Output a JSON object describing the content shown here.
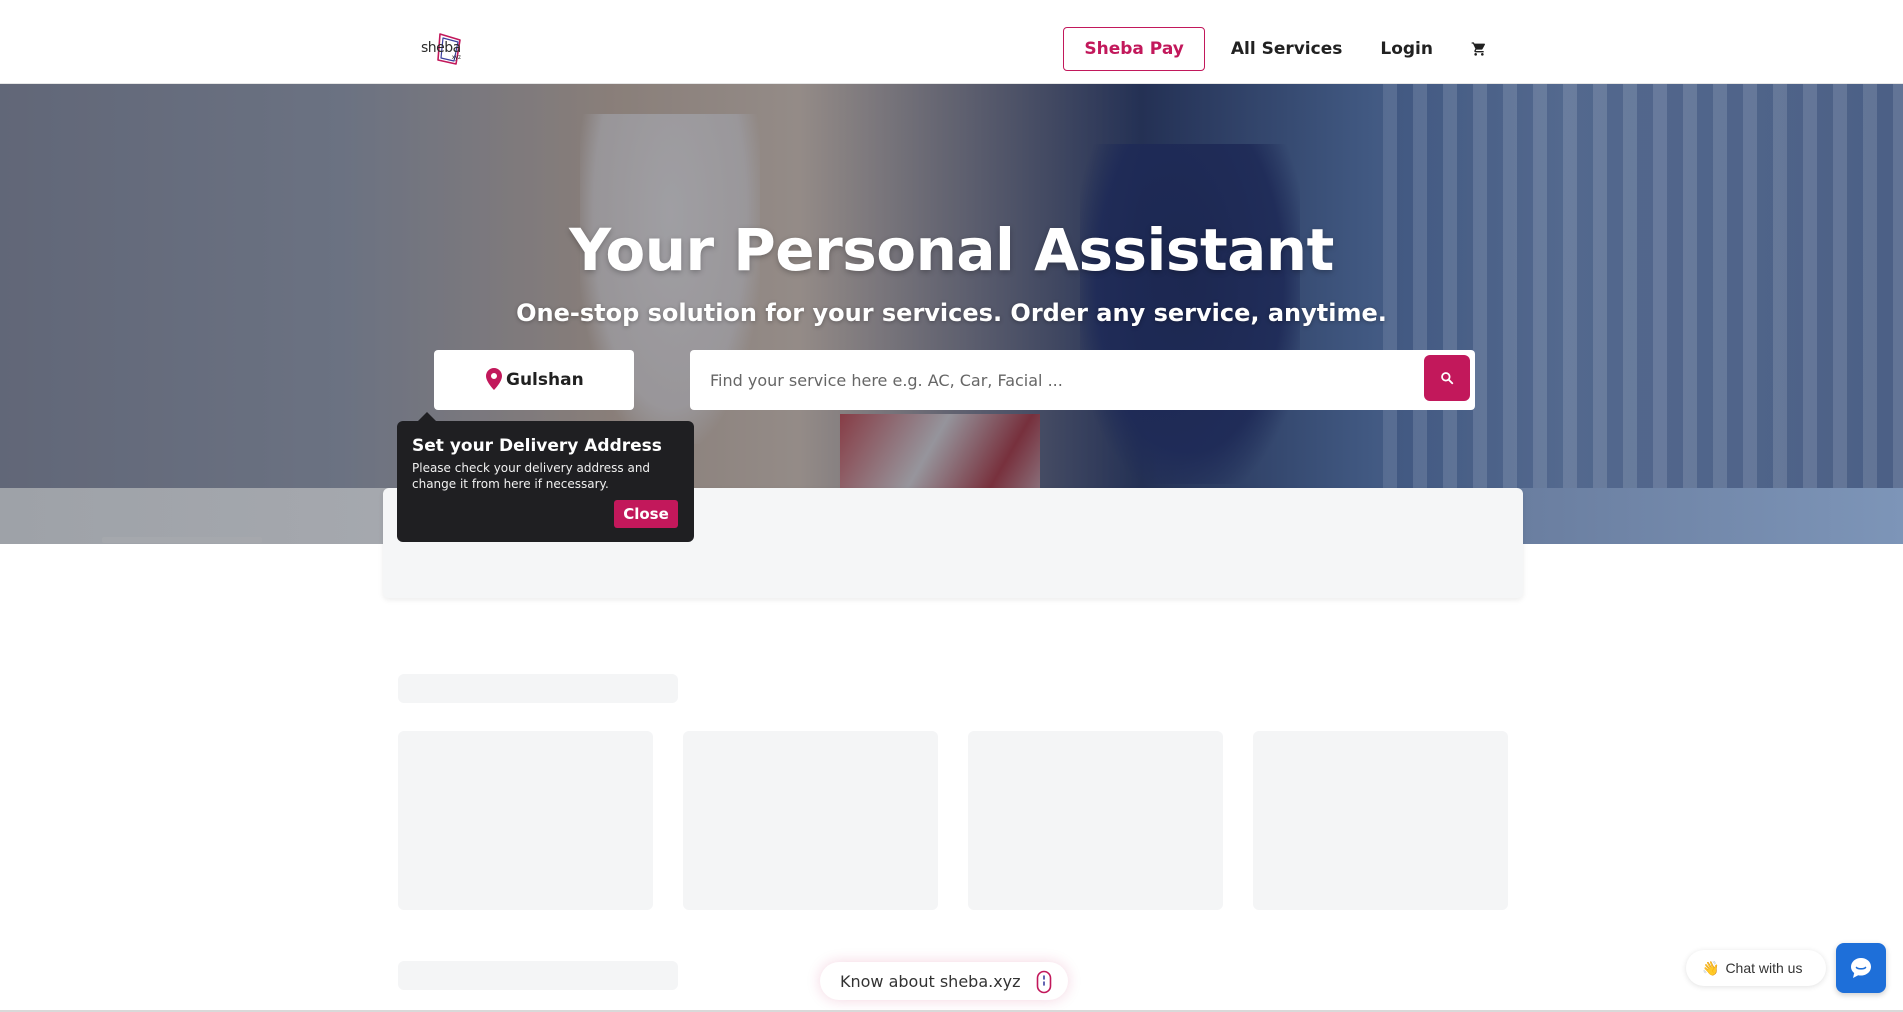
{
  "header": {
    "logo_text": "sheba",
    "logo_sub": "xyz",
    "nav": {
      "sheba_pay": "Sheba Pay",
      "all_services": "All Services",
      "login": "Login"
    },
    "cart_icon": "cart-icon"
  },
  "hero": {
    "title": "Your Personal Assistant",
    "subtitle": "One-stop solution for your services. Order any service, anytime.",
    "location": {
      "label": "Gulshan",
      "icon": "location-pin-icon"
    },
    "search": {
      "placeholder": "Find your service here e.g. AC, Car, Facial ...",
      "value": ""
    }
  },
  "tooltip": {
    "title": "Set your Delivery Address",
    "text": "Please check your delivery address and change it from here if necessary.",
    "close_label": "Close"
  },
  "footer_widgets": {
    "know_about": "Know about sheba.xyz",
    "chat_label": "Chat with us",
    "chat_icon": "chat-bubble-icon"
  },
  "colors": {
    "brand": "#c2185b",
    "chat_blue": "#1e6fd9",
    "tooltip_bg": "#1f1f22",
    "skeleton": "#f4f5f6"
  }
}
